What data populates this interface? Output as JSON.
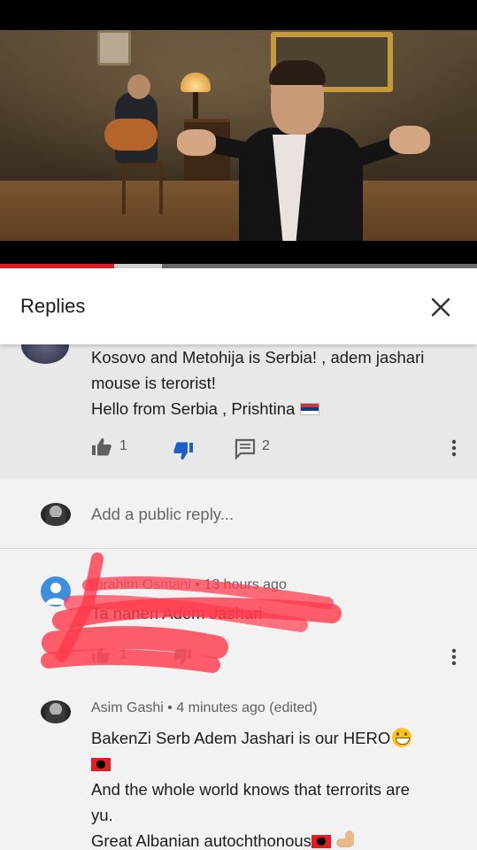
{
  "video": {
    "progress_played": 0.24,
    "progress_buffered": 0.34,
    "colors": {
      "played": "#e51b23",
      "buffered": "#cfcfcf",
      "track": "#6b6b6b"
    }
  },
  "replies_panel": {
    "title": "Replies",
    "close_icon": "close-icon"
  },
  "parent_comment": {
    "lines": [
      "Kosovo and Metohija is Serbia! , adem jashari",
      "mouse is terorist!",
      "Hello from Serbia , Prishtina"
    ],
    "likes": "1",
    "replies": "2",
    "flag": "serbia-flag"
  },
  "add_reply": {
    "placeholder": "Add a public reply..."
  },
  "replies": [
    {
      "author": "Ibrahim Osmani",
      "separator": "•",
      "time": "13 hours ago",
      "text": "Ta  nanen Adem Jashari",
      "likes": "1",
      "author_color": "#3d8fde",
      "scribbled": true
    },
    {
      "author": "Asim Gashi",
      "separator": "•",
      "time": "4 minutes ago (edited)",
      "lines": [
        "BakenZi Serb Adem Jashari is our HERO",
        "And the whole world knows that terrorits are",
        "yu.",
        "Great Albanian autochthonous"
      ]
    }
  ]
}
